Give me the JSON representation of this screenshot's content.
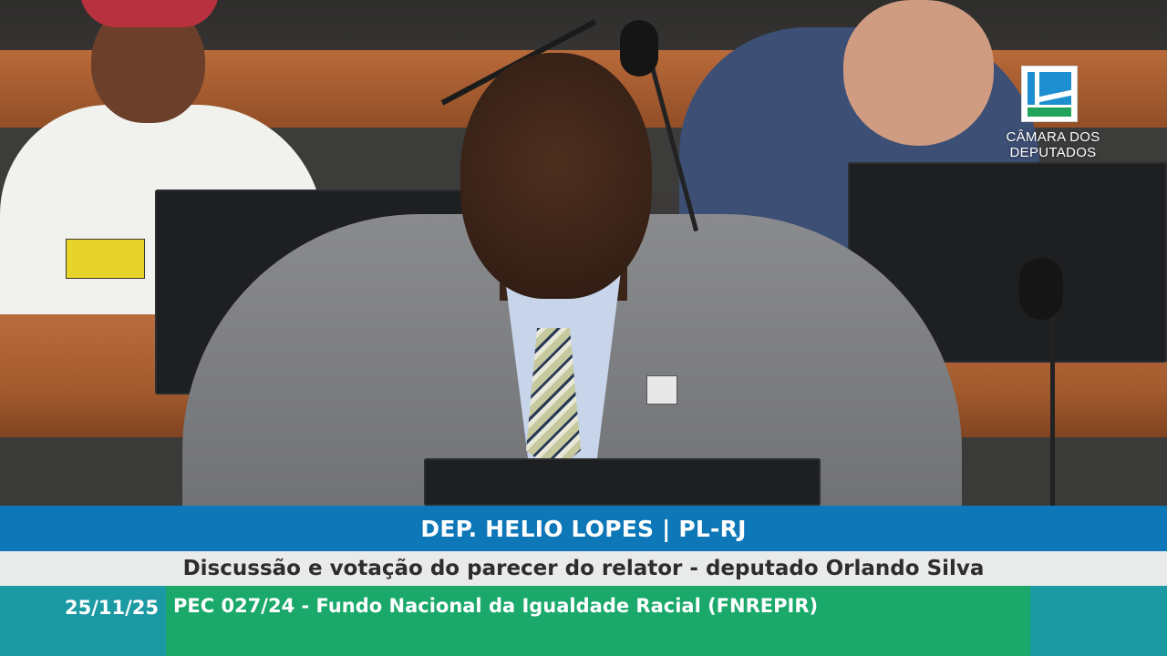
{
  "broadcaster": {
    "logo_text_line1": "CÂMARA DOS",
    "logo_text_line2": "DEPUTADOS",
    "logo_icon": "camara-dos-deputados-logo-icon",
    "colors": {
      "logo_blue": "#1d8fd0",
      "logo_green": "#21a35b"
    }
  },
  "lower_third": {
    "speaker_name": "DEP. HELIO LOPES | PL-RJ",
    "subtitle": "Discussão e votação do parecer do relator - deputado Orlando Silva",
    "date": "25/11/25",
    "topic": "PEC 027/24 - Fundo Nacional da Igualdade Racial (FNREPIR)",
    "colors": {
      "name_bar": "#0d77b8",
      "subtitle_bar": "#e9eaea",
      "info_bar": "#1b9aa3",
      "topic_box": "#1aa96a"
    }
  }
}
